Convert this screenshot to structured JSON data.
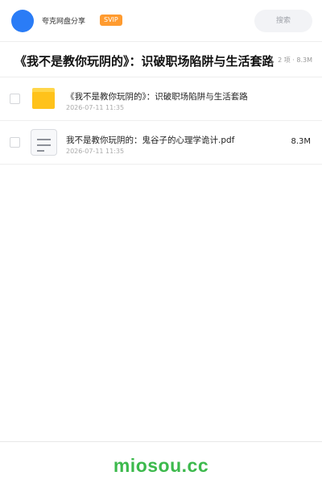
{
  "header": {
    "brand": "夸克网盘分享",
    "badge": "SVIP",
    "search_placeholder": "搜索"
  },
  "folder": {
    "title": "《我不是教你玩阴的》：识破职场陷阱与生活套路",
    "meta": "2 项 · 8.3M"
  },
  "items": [
    {
      "type": "folder",
      "name": "《我不是教你玩阴的》：识破职场陷阱与生活套路",
      "date": "2026-07-11 11:35",
      "size": ""
    },
    {
      "type": "file",
      "name": "我不是教你玩阴的：鬼谷子的心理学诡计.pdf",
      "date": "2026-07-11 11:35",
      "size": "8.3M"
    }
  ],
  "footer": {
    "brand": "miosou.cc"
  },
  "colors": {
    "avatar": "#2a7cf6",
    "badge": "#ff9b2f",
    "folder": "#ffc21a",
    "footer_brand": "#3cb94c"
  }
}
